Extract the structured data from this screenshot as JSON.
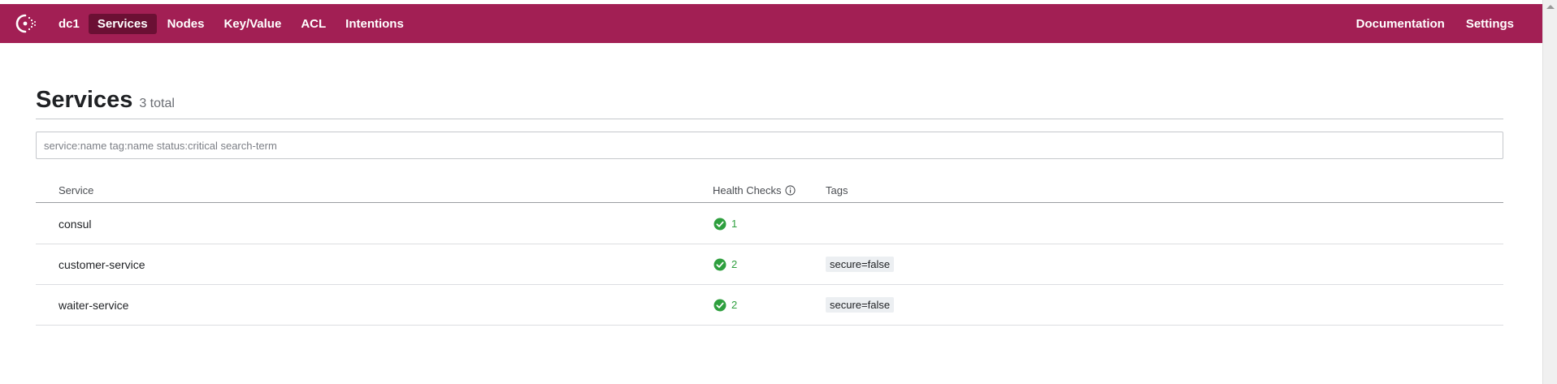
{
  "nav": {
    "datacenter": "dc1",
    "items": [
      {
        "label": "Services",
        "active": true
      },
      {
        "label": "Nodes",
        "active": false
      },
      {
        "label": "Key/Value",
        "active": false
      },
      {
        "label": "ACL",
        "active": false
      },
      {
        "label": "Intentions",
        "active": false
      }
    ],
    "right_items": [
      {
        "label": "Documentation"
      },
      {
        "label": "Settings"
      }
    ],
    "background_color": "#a21f54",
    "active_color": "#6b1034",
    "logo_icon": "consul-logo-icon"
  },
  "page": {
    "title": "Services",
    "count": "3 total"
  },
  "search": {
    "placeholder": "service:name tag:name status:critical search-term",
    "value": ""
  },
  "table": {
    "columns": {
      "service": "Service",
      "health": "Health Checks",
      "tags": "Tags"
    },
    "health_info_icon": "info-icon",
    "rows": [
      {
        "name": "consul",
        "passing": "1",
        "tags": []
      },
      {
        "name": "customer-service",
        "passing": "2",
        "tags": [
          "secure=false"
        ]
      },
      {
        "name": "waiter-service",
        "passing": "2",
        "tags": [
          "secure=false"
        ]
      }
    ],
    "passing_color": "#2e9f3e",
    "check_icon": "check-circle-icon"
  }
}
